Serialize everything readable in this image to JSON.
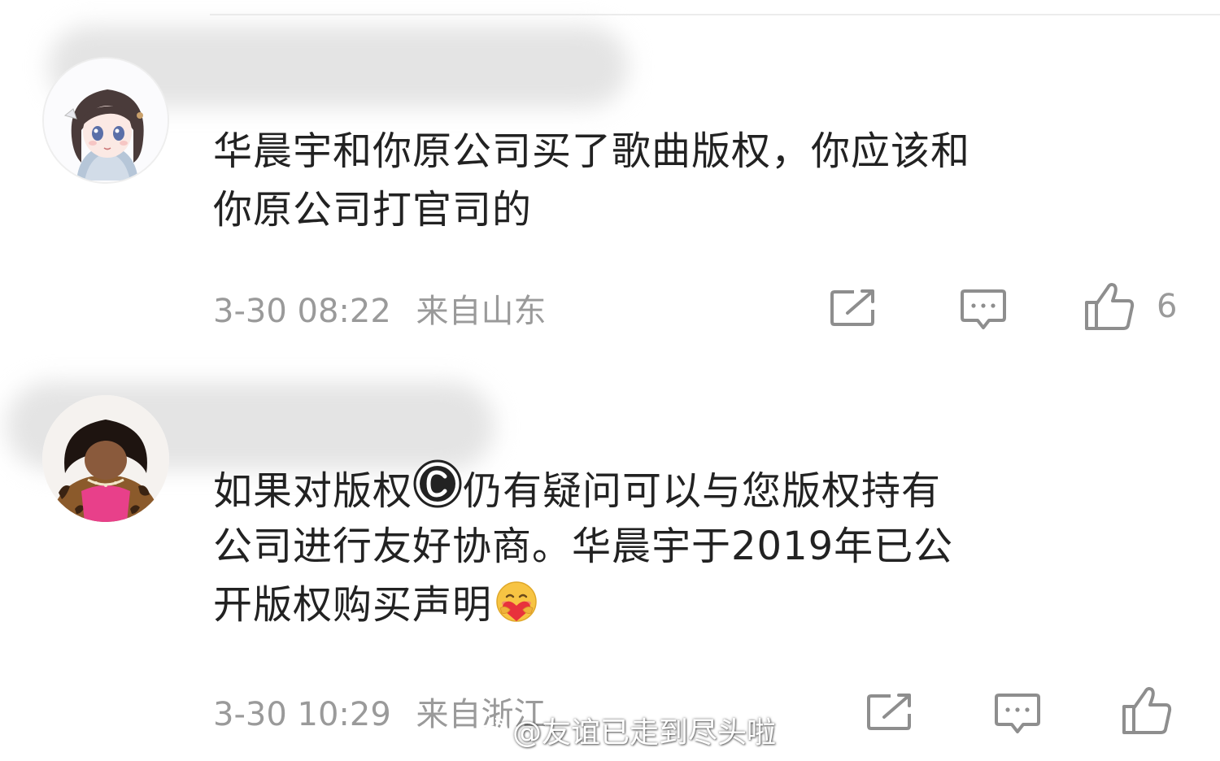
{
  "comments": [
    {
      "text_lines": [
        "华晨宇和你原公司买了歌曲版权，你应该和",
        "你原公司打官司的"
      ],
      "date": "3-30 08:22",
      "location": "来自山东",
      "like_count": "6",
      "avatar": "anime-girl-avatar",
      "username_blurred": true
    },
    {
      "text_lines": [
        "如果对版权",
        "仍有疑问可以与您版权持有",
        "公司进行友好协商。华晨宇于2019年已公",
        "开版权购买声明"
      ],
      "inline_icons": [
        "copyright-icon",
        "hug-emoji"
      ],
      "date": "3-30 10:29",
      "location": "来自浙江",
      "like_count": "",
      "avatar": "pink-outfit-avatar",
      "username_blurred": true
    }
  ],
  "watermark": {
    "text": "@友谊已走到尽头啦",
    "icon": "weibo-logo-icon"
  },
  "colors": {
    "text": "#222222",
    "meta": "#9a9a9a",
    "icon": "#8e8e8e"
  }
}
